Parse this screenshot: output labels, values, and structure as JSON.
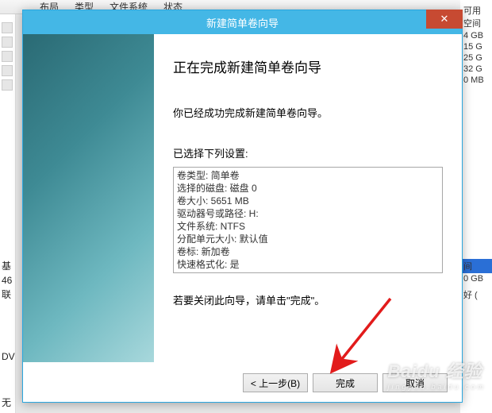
{
  "bg": {
    "cols": [
      "布局",
      "类型",
      "文件系统",
      "状态"
    ],
    "right_header": "可用空间",
    "right_vals": [
      "4 GB",
      "15 G",
      "25 G",
      "32 G",
      "0 MB"
    ],
    "side_labels": [
      "基",
      "46",
      "联"
    ],
    "side_labels2": [
      "间",
      "0 GB",
      "好 ("
    ],
    "bottom1": "DV",
    "bottom2": "无"
  },
  "dialog": {
    "title": "新建简单卷向导",
    "heading": "正在完成新建简单卷向导",
    "msg_done": "你已经成功完成新建简单卷向导。",
    "msg_selected": "已选择下列设置:",
    "summary": [
      "卷类型: 简单卷",
      "选择的磁盘: 磁盘 0",
      "卷大小: 5651 MB",
      "驱动器号或路径: H:",
      "文件系统: NTFS",
      "分配单元大小: 默认值",
      "卷标: 新加卷",
      "快速格式化: 是"
    ],
    "msg_close": "若要关闭此向导，请单击\"完成\"。",
    "buttons": {
      "back": "< 上一步(B)",
      "finish": "完成",
      "cancel": "取消"
    }
  },
  "watermark": {
    "brand": "Baidu 经验",
    "sub": "jingyan.baidu.com"
  }
}
